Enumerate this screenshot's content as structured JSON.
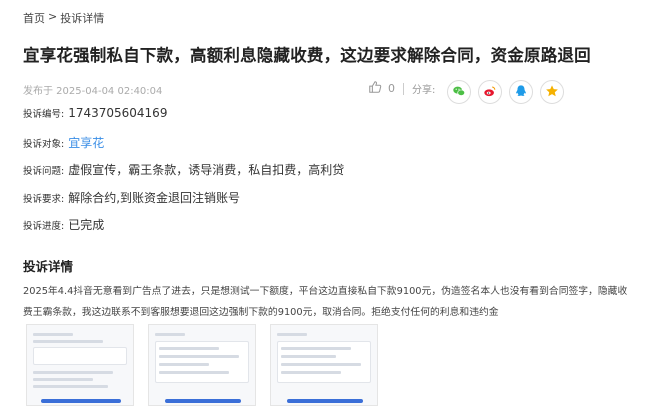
{
  "breadcrumb": {
    "home": "首页",
    "separator": ">",
    "current": "投诉详情"
  },
  "title": "宜享花强制私自下款，高额利息隐藏收费，这边要求解除合同，资金原路退回",
  "meta": {
    "published": "发布于 2025-04-04 02:40:04"
  },
  "actions": {
    "like_count": "0",
    "share_label": "分享:"
  },
  "share_icons": [
    "wechat-icon",
    "weibo-icon",
    "qq-icon",
    "qzone-icon"
  ],
  "fields": {
    "id": {
      "label": "投诉编号:",
      "value": "1743705604169"
    },
    "target": {
      "label": "投诉对象:",
      "value": "宜享花"
    },
    "issue": {
      "label": "投诉问题:",
      "value": "虚假宣传，霸王条款，诱导消费，私自扣费，高利贷"
    },
    "demand": {
      "label": "投诉要求:",
      "value": "解除合约,到账资金退回注销账号"
    },
    "progress": {
      "label": "投诉进度:",
      "value": "已完成"
    }
  },
  "section_title": "投诉详情",
  "description": "2025年4.4抖音无意看到广告点了进去，只是想测试一下额度，平台这边直接私自下款9100元，伪造签名本人也没有看到合同签字，隐藏收费王霸条款，我这边联系不到客服想要退回这边强制下款的9100元，取消合同。拒绝支付任何的利息和违约金",
  "colors": {
    "link": "#3a8ee6",
    "wechat": "#4cbf45",
    "weibo": "#e6162d",
    "qq": "#1e9be8",
    "qzone": "#f5b100"
  }
}
